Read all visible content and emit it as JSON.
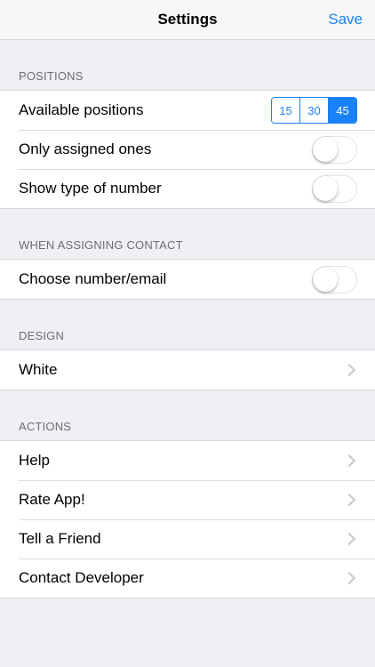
{
  "nav": {
    "title": "Settings",
    "save_label": "Save"
  },
  "colors": {
    "accent": "#1a82f7",
    "background": "#efeff4"
  },
  "sections": {
    "positions": {
      "header": "POSITIONS",
      "available_label": "Available positions",
      "segments": [
        "15",
        "30",
        "45"
      ],
      "selected_segment": "45",
      "only_assigned_label": "Only assigned ones",
      "only_assigned_on": false,
      "show_type_label": "Show type of number",
      "show_type_on": false
    },
    "assigning": {
      "header": "WHEN ASSIGNING CONTACT",
      "choose_label": "Choose number/email",
      "choose_on": false
    },
    "design": {
      "header": "DESIGN",
      "theme_label": "White"
    },
    "actions": {
      "header": "ACTIONS",
      "items": [
        "Help",
        "Rate App!",
        "Tell a Friend",
        "Contact Developer"
      ]
    }
  },
  "icons": {
    "chevron": "chevron-right-icon"
  }
}
